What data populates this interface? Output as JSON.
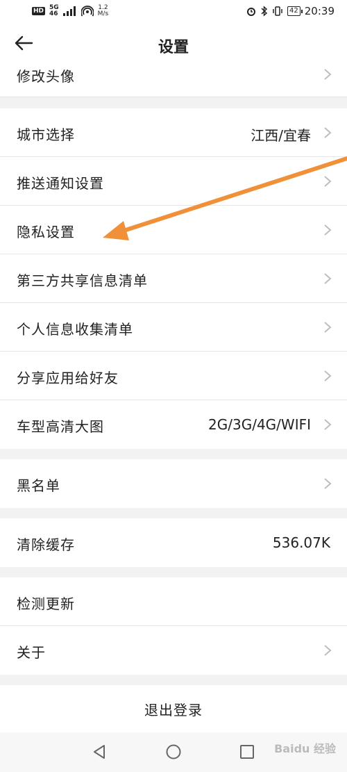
{
  "status_bar": {
    "hd": "HD",
    "net_top": "5G",
    "net_bottom": "46",
    "speed_top": "1.2",
    "speed_bottom": "M/s",
    "battery": "42",
    "time": "20:39"
  },
  "header": {
    "title": "设置"
  },
  "items": [
    {
      "label": "修改头像",
      "value": "",
      "arrow": true
    },
    {
      "label": "城市选择",
      "value": "江西/宜春",
      "arrow": true
    },
    {
      "label": "推送通知设置",
      "value": "",
      "arrow": true
    },
    {
      "label": "隐私设置",
      "value": "",
      "arrow": true
    },
    {
      "label": "第三方共享信息清单",
      "value": "",
      "arrow": true
    },
    {
      "label": "个人信息收集清单",
      "value": "",
      "arrow": true
    },
    {
      "label": "分享应用给好友",
      "value": "",
      "arrow": true
    },
    {
      "label": "车型高清大图",
      "value": "2G/3G/4G/WIFI",
      "arrow": true
    },
    {
      "label": "黑名单",
      "value": "",
      "arrow": true
    },
    {
      "label": "清除缓存",
      "value": "536.07K",
      "arrow": false
    },
    {
      "label": "检测更新",
      "value": "",
      "arrow": false
    },
    {
      "label": "关于",
      "value": "",
      "arrow": true
    }
  ],
  "logout_label": "退出登录",
  "watermark": "Baidu 经验",
  "colors": {
    "annotation_arrow": "#f0913a",
    "background": "#f2f2f2"
  }
}
